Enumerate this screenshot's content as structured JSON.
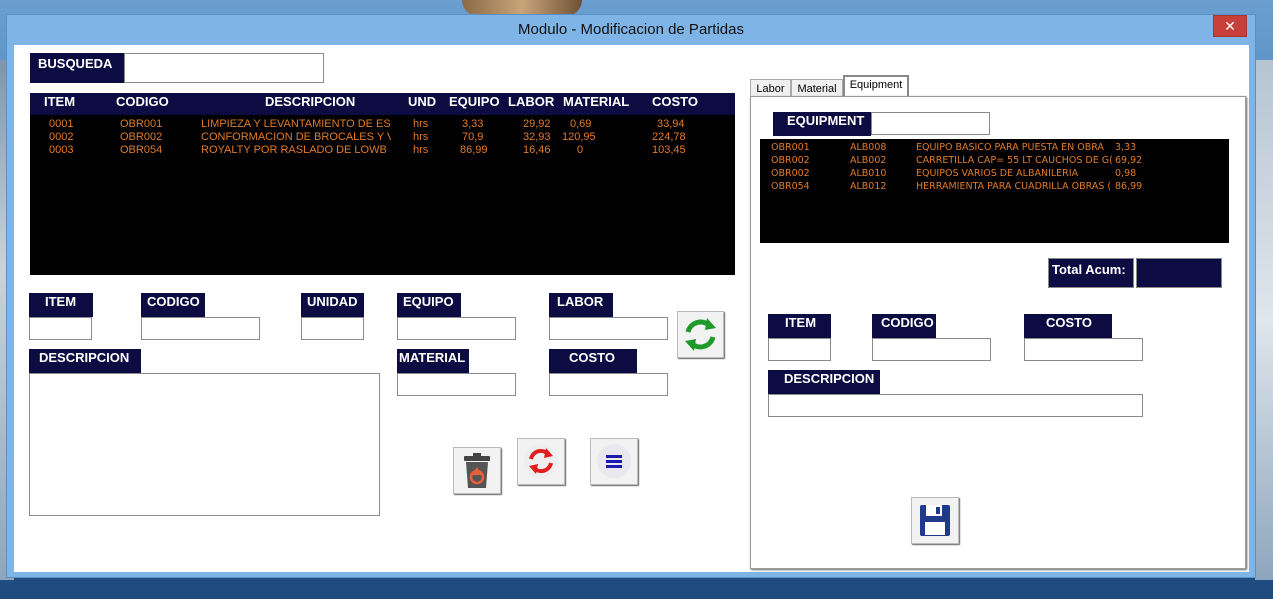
{
  "window": {
    "title": "Modulo - Modificacion de Partidas",
    "close_label": "✕"
  },
  "search": {
    "label": "BUSQUEDA",
    "value": ""
  },
  "main_grid": {
    "headers": [
      "ITEM",
      "CODIGO",
      "DESCRIPCION",
      "UND",
      "EQUIPO",
      "LABOR",
      "MATERIAL",
      "COSTO"
    ],
    "rows": [
      [
        "0001",
        "OBR001",
        "LIMPIEZA Y LEVANTAMIENTO DE ES(",
        "hrs",
        "3,33",
        "29,92",
        "0,69",
        "33,94"
      ],
      [
        "0002",
        "OBR002",
        "CONFORMACION DE BROCALES Y V",
        "hrs",
        "70,9",
        "32,93",
        "120,95",
        "224,78"
      ],
      [
        "0003",
        "OBR054",
        "ROYALTY POR RASLADO DE LOWB",
        "hrs",
        "86,99",
        "16,46",
        "0",
        "103,45"
      ]
    ]
  },
  "form": {
    "item_label": "ITEM",
    "codigo_label": "CODIGO",
    "unidad_label": "UNIDAD",
    "equipo_label": "EQUIPO",
    "labor_label": "LABOR",
    "descripcion_label": "DESCRIPCION",
    "material_label": "MATERIAL",
    "costo_label": "COSTO"
  },
  "tabs": [
    "Labor",
    "Material",
    "Equipment"
  ],
  "equipment": {
    "label": "EQUIPMENT",
    "search_value": "",
    "rows": [
      [
        "OBR001",
        "ALB008",
        "EQUIPO BASICO PARA PUESTA EN OBRA",
        "3,33"
      ],
      [
        "OBR002",
        "ALB002",
        "CARRETILLA CAP= 55 LT CAUCHOS DE G(",
        "69,92"
      ],
      [
        "OBR002",
        "ALB010",
        "EQUIPOS VARIOS DE ALBAÑILERIA",
        "0,98"
      ],
      [
        "OBR054",
        "ALB012",
        "HERRAMIENTA PARA CUADRILLA OBRAS (",
        "86,99"
      ]
    ],
    "total_label": "Total Acum:",
    "total_value": "",
    "item_label": "ITEM",
    "codigo_label": "CODIGO",
    "costo_label": "COSTO",
    "descripcion_label": "DESCRIPCION"
  },
  "colors": {
    "header_bg": "#0c0c42",
    "grid_text": "#e07b2a",
    "grid_bg": "#000000"
  },
  "icons": {
    "refresh_green": "refresh-arrows-icon",
    "delete": "recycle-bin-icon",
    "reload_red": "reload-icon",
    "menu": "menu-icon",
    "save": "floppy-disk-icon"
  }
}
